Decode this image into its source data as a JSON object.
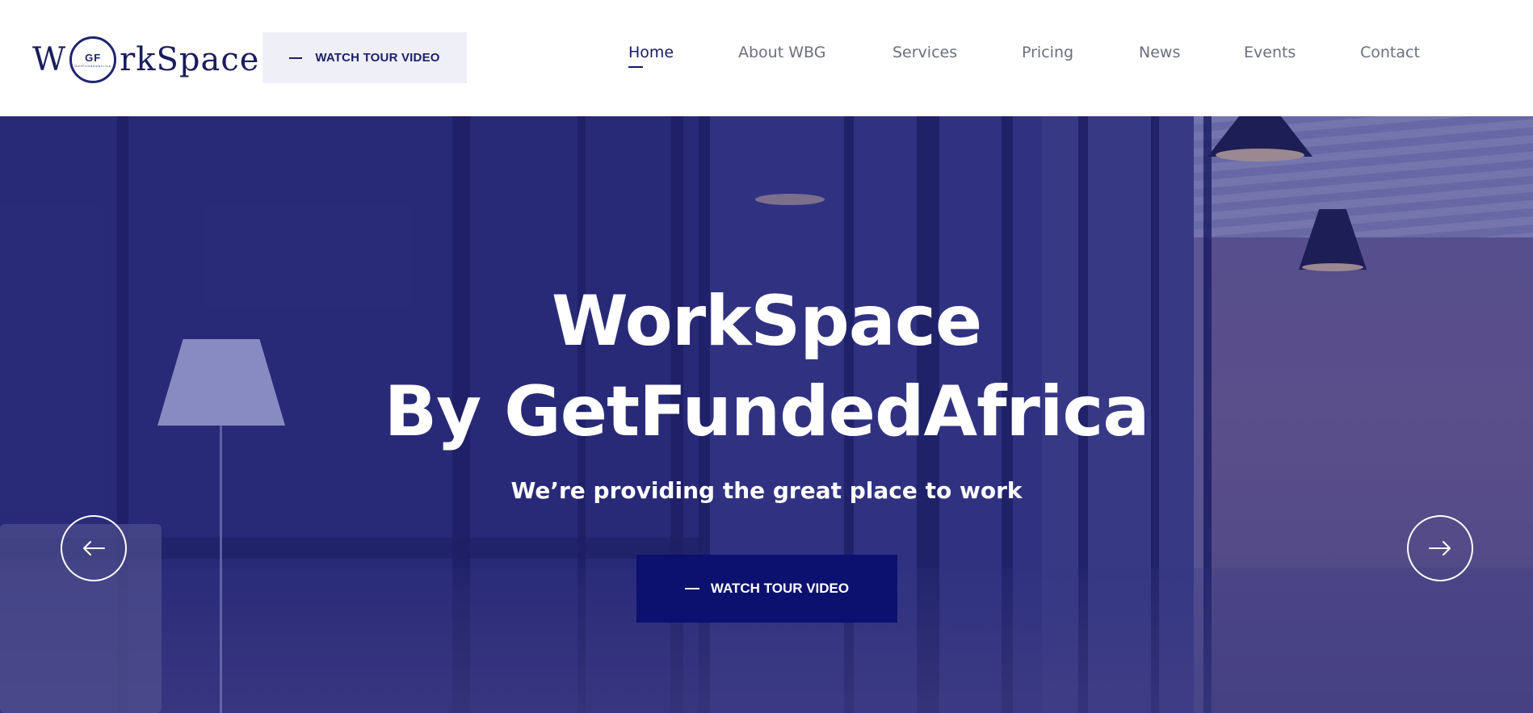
{
  "header": {
    "logo": {
      "prefix": "W",
      "badge": "GF",
      "badge_small": "GetFundedAfrica",
      "suffix": "rkSpace"
    },
    "cta_label": "WATCH TOUR VIDEO",
    "nav": [
      {
        "label": "Home",
        "active": true
      },
      {
        "label": "About WBG",
        "active": false
      },
      {
        "label": "Services",
        "active": false
      },
      {
        "label": "Pricing",
        "active": false
      },
      {
        "label": "News",
        "active": false
      },
      {
        "label": "Events",
        "active": false
      },
      {
        "label": "Contact",
        "active": false
      }
    ]
  },
  "hero": {
    "title_line1": "WorkSpace",
    "title_line2": "By GetFundedAfrica",
    "subtitle": "We’re providing the great place to work",
    "cta_label": "WATCH TOUR VIDEO",
    "prev_icon": "arrow-left-icon",
    "next_icon": "arrow-right-icon"
  },
  "colors": {
    "brand_navy": "#0c106e",
    "overlay": "#202178",
    "nav_text": "#6b6f7e",
    "nav_active": "#161a66"
  }
}
